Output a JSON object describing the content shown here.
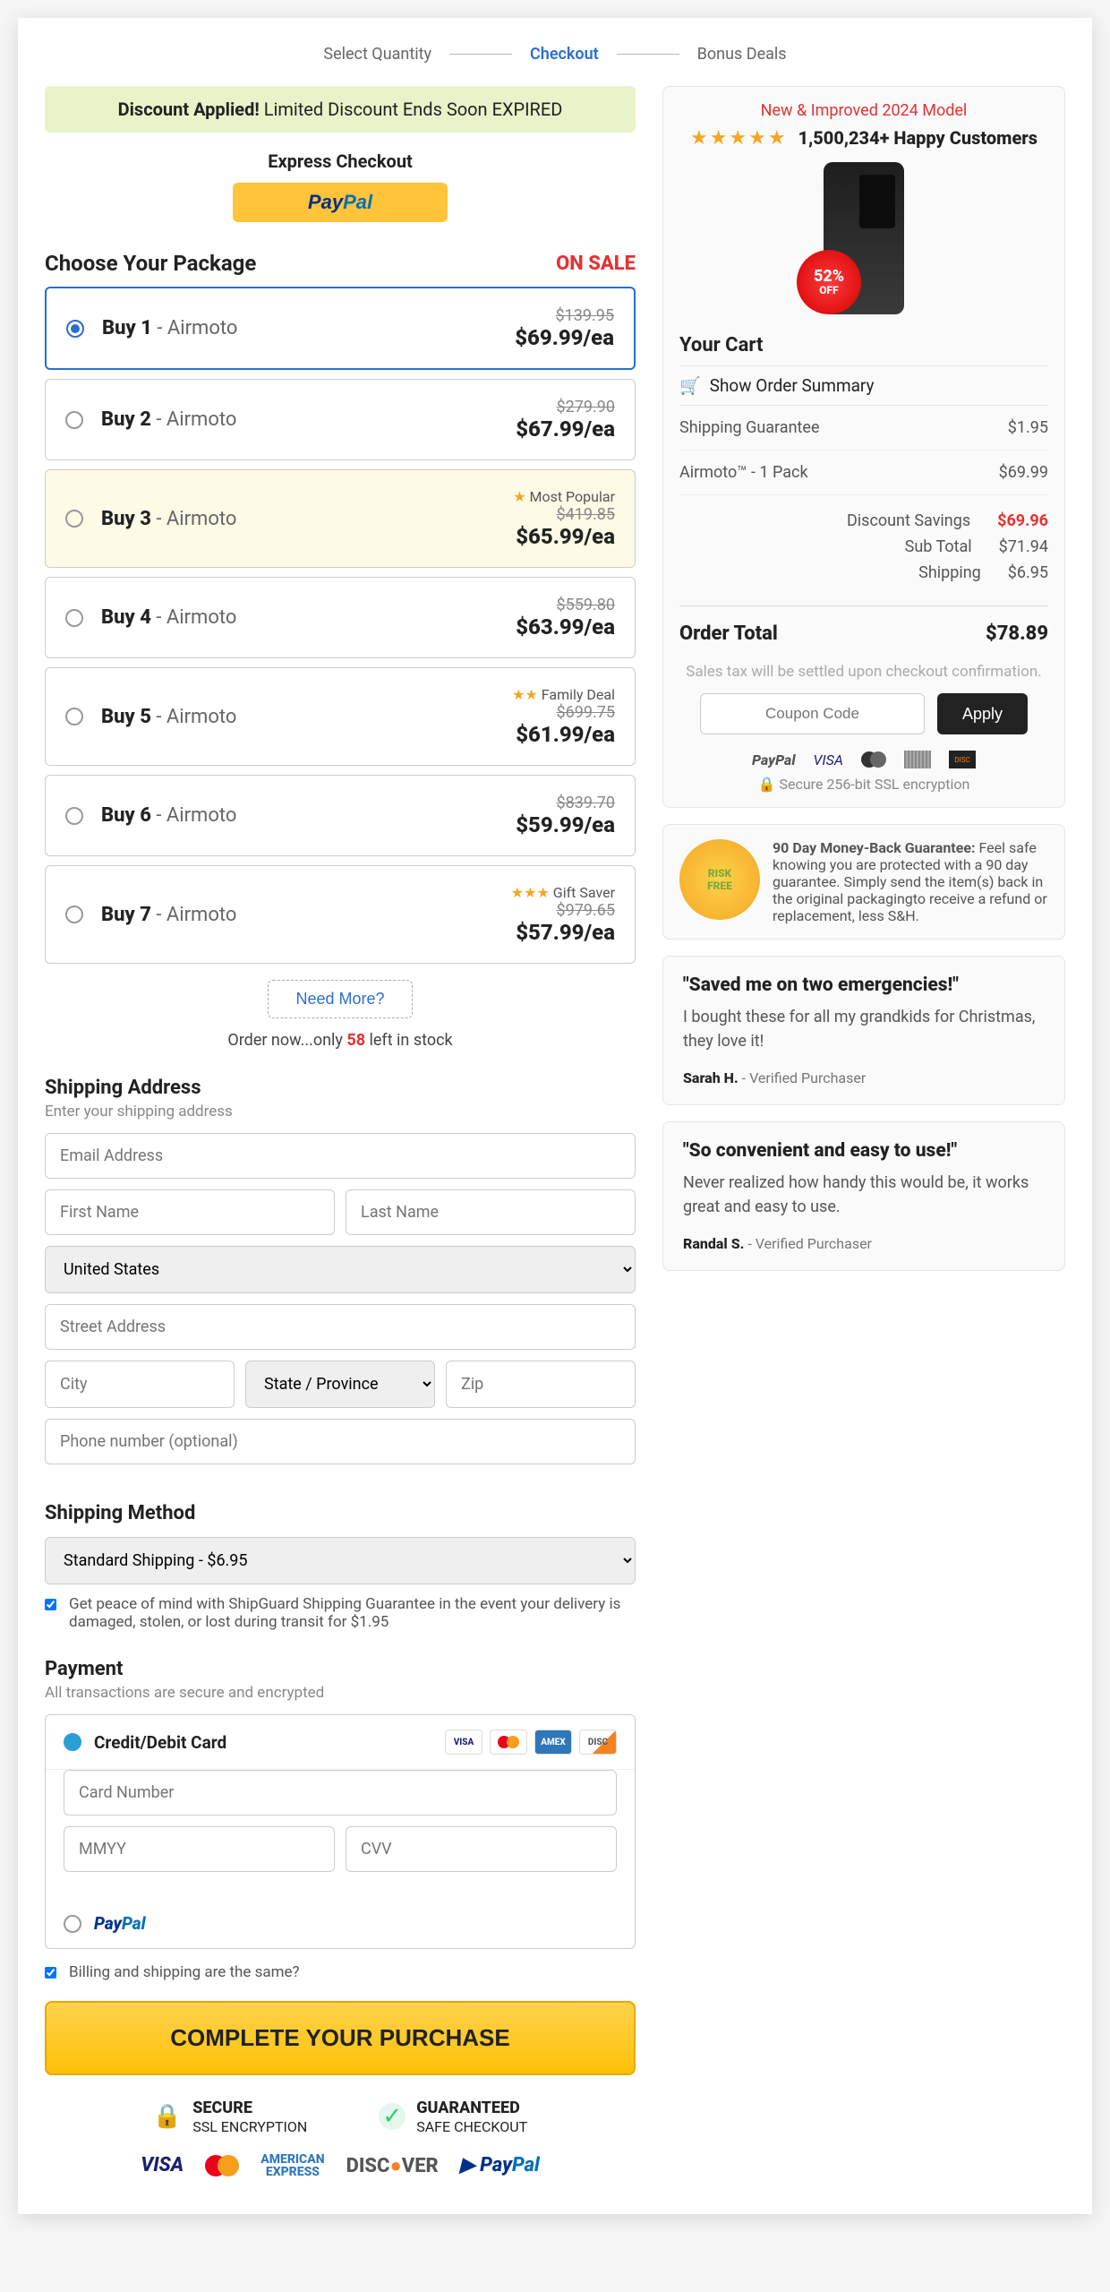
{
  "steps": [
    "Select Quantity",
    "Checkout",
    "Bonus Deals"
  ],
  "active_step": 1,
  "banner": {
    "strong": "Discount Applied!",
    "text": " Limited Discount Ends Soon ",
    "timer": "EXPIRED"
  },
  "express_title": "Express Checkout",
  "choose_title": "Choose Your Package",
  "onsale": "ON SALE",
  "packages": [
    {
      "qty": "Buy 1",
      "name": " - Airmoto",
      "old": "$139.95",
      "price": "$69.99/ea",
      "selected": true
    },
    {
      "qty": "Buy 2",
      "name": " - Airmoto",
      "old": "$279.90",
      "price": "$67.99/ea"
    },
    {
      "qty": "Buy 3",
      "name": " - Airmoto",
      "old": "$419.85",
      "price": "$65.99/ea",
      "badge": "Most Popular",
      "stars": 1,
      "popular": true
    },
    {
      "qty": "Buy 4",
      "name": " - Airmoto",
      "old": "$559.80",
      "price": "$63.99/ea"
    },
    {
      "qty": "Buy 5",
      "name": " - Airmoto",
      "old": "$699.75",
      "price": "$61.99/ea",
      "badge": "Family Deal",
      "stars": 2
    },
    {
      "qty": "Buy 6",
      "name": " - Airmoto",
      "old": "$839.70",
      "price": "$59.99/ea"
    },
    {
      "qty": "Buy 7",
      "name": " - Airmoto",
      "old": "$979.65",
      "price": "$57.99/ea",
      "badge": "Gift Saver",
      "stars": 3
    }
  ],
  "need_more": "Need More?",
  "stock_before": "Order now...only ",
  "stock_num": "58",
  "stock_after": " left in stock",
  "shipping_title": "Shipping Address",
  "shipping_sub": "Enter your shipping address",
  "ph": {
    "email": "Email Address",
    "first": "First Name",
    "last": "Last Name",
    "street": "Street Address",
    "city": "City",
    "state": "State / Province",
    "zip": "Zip",
    "phone": "Phone number (optional)"
  },
  "country": "United States",
  "method_title": "Shipping Method",
  "method_value": "Standard Shipping - $6.95",
  "shipguard": "Get peace of mind with ShipGuard Shipping Guarantee in the event your delivery is damaged, stolen, or lost during transit for $1.95",
  "payment_title": "Payment",
  "payment_sub": "All transactions are secure and encrypted",
  "pay_card": "Credit/Debit Card",
  "card_ph": {
    "num": "Card Number",
    "exp": "MMYY",
    "cvv": "CVV"
  },
  "billing_same": "Billing and shipping are the same?",
  "complete": "COMPLETE YOUR PURCHASE",
  "trust": [
    {
      "icon": "🔒",
      "t1": "SECURE",
      "t2": "SSL ENCRYPTION",
      "color": "#2ecc71"
    },
    {
      "icon": "✔",
      "t1": "GUARANTEED",
      "t2": "SAFE CHECKOUT",
      "color": "#2ecc71"
    }
  ],
  "right": {
    "new_model": "New & Improved 2024 Model",
    "customers": "1,500,234+ Happy Customers",
    "discount_badge1": "52%",
    "discount_badge2": "OFF",
    "cart_title": "Your Cart",
    "summary": "Show Order Summary",
    "lines": [
      {
        "label": "Shipping Guarantee",
        "value": "$1.95"
      },
      {
        "label": "Airmoto™ - 1 Pack",
        "value": "$69.99"
      }
    ],
    "totals": {
      "discount_label": "Discount Savings",
      "discount_value": "$69.96",
      "sub_label": "Sub Total",
      "sub_value": "$71.94",
      "ship_label": "Shipping",
      "ship_value": "$6.95"
    },
    "order_total_label": "Order Total",
    "order_total_value": "$78.89",
    "tax_note": "Sales tax will be settled upon checkout confirmation.",
    "coupon_ph": "Coupon Code",
    "apply": "Apply",
    "ssl": "Secure 256-bit SSL encryption",
    "guarantee_title": "90 Day Money-Back Guarantee:",
    "guarantee_body": " Feel safe knowing you are protected with a 90 day guarantee. Simply send the item(s) back in the original packagingto receive a refund or replacement, less S&H.",
    "seal1": "RISK",
    "seal2": "FREE"
  },
  "testimonials": [
    {
      "q": "\"Saved me on two emergencies!\"",
      "body": "I bought these for all my grandkids for Christmas, they love it!",
      "name": "Sarah H.",
      "suffix": " - Verified Purchaser"
    },
    {
      "q": "\"So convenient and easy to use!\"",
      "body": "Never realized how handy this would be, it works great and easy to use.",
      "name": "Randal S.",
      "suffix": " - Verified Purchaser"
    }
  ]
}
